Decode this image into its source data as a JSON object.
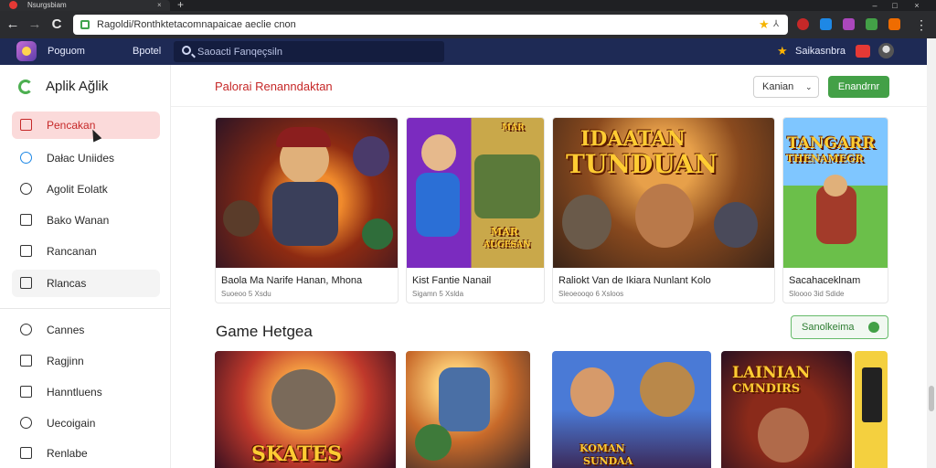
{
  "browser": {
    "tab_title": "Nsurgsbiam",
    "tab_close": "×",
    "new_tab": "+",
    "window_buttons": [
      "–",
      "□",
      "×"
    ],
    "back": "←",
    "forward": "→",
    "reload": "C",
    "url": "Ragoldi/Ronthktetacomnapaicae aeclie cnon"
  },
  "app_header": {
    "name": "Poguom",
    "link": "Bpotel",
    "search_placeholder": "Saoacti Fanqeçsiln",
    "user_name": "Saikasnbra"
  },
  "sidebar": {
    "title": "Aplik Ağlik",
    "items": [
      {
        "label": "Pencakan",
        "state": "active"
      },
      {
        "label": "Dałac Uniides"
      },
      {
        "label": "Agolit Eolatk"
      },
      {
        "label": "Bako Wanan"
      },
      {
        "label": "Rancanan"
      },
      {
        "label": "Rlancas",
        "state": "highlight"
      }
    ],
    "secondary_items": [
      {
        "label": "Cannes"
      },
      {
        "label": "Ragjinn"
      },
      {
        "label": "Hanntluens"
      },
      {
        "label": "Uecoigain"
      },
      {
        "label": "Renlabe"
      }
    ]
  },
  "main": {
    "section_title": "Palorai Renanndaktan",
    "sort_label": "Kanian",
    "sort_chevron": "⌄",
    "primary_button": "Enandrnr",
    "cards": [
      {
        "title": "Baola Ma Narife Hanan, Mhona",
        "meta": "Suoeoo 5 Xsdu"
      },
      {
        "title": "Kist Fantie Nanail",
        "meta": "Sigamn 5 Xslda"
      },
      {
        "title": "Raliokt Van de Ikiara Nunlant Kolo",
        "meta": "Sleoeooqo 6 Xsloos",
        "art_text": [
          "IDAATAN",
          "TUNDUAN"
        ]
      },
      {
        "title": "Sacahaceklnam",
        "meta": "Sloooo 3id Sdide",
        "art_text": [
          "TANGARR",
          "THENAMEGR"
        ]
      }
    ],
    "side_art_text": [
      "MAR",
      "AUGESAN"
    ],
    "section2_title": "Game Hetgea",
    "section2_button": "Sanolkeima",
    "cards2_art_text": [
      "SKATES",
      "KOMAN",
      "SUNDAA",
      "LAINIAN",
      "CMNDIRS"
    ]
  }
}
